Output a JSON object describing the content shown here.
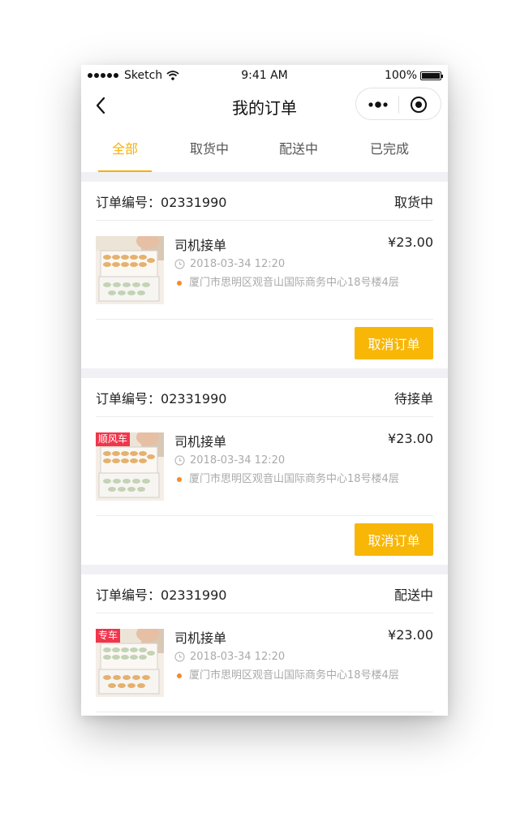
{
  "status_bar": {
    "carrier": "Sketch",
    "time": "9:41 AM",
    "battery": "100%"
  },
  "nav": {
    "title": "我的订单",
    "back_icon": "chevron-left-icon",
    "more_icon": "more-dots-icon",
    "close_icon": "target-circle-icon"
  },
  "tabs": [
    {
      "label": "全部",
      "active": true
    },
    {
      "label": "取货中",
      "active": false
    },
    {
      "label": "配送中",
      "active": false
    },
    {
      "label": "已完成",
      "active": false
    }
  ],
  "colors": {
    "accent": "#f6b10a",
    "button": "#f8b607",
    "tag": "#f0364c",
    "address_dot": "#f58a2a"
  },
  "orders": [
    {
      "order_label": "订单编号：",
      "order_no": "02331990",
      "status": "取货中",
      "item_title": "司机接单",
      "price": "¥23.00",
      "time": "2018-03-34 12:20",
      "address": "厦门市思明区观音山国际商务中心18号楼4层",
      "tag": "",
      "action": "取消订单"
    },
    {
      "order_label": "订单编号：",
      "order_no": "02331990",
      "status": "待接单",
      "item_title": "司机接单",
      "price": "¥23.00",
      "time": "2018-03-34 12:20",
      "address": "厦门市思明区观音山国际商务中心18号楼4层",
      "tag": "顺风车",
      "action": "取消订单"
    },
    {
      "order_label": "订单编号：",
      "order_no": "02331990",
      "status": "配送中",
      "item_title": "司机接单",
      "price": "¥23.00",
      "time": "2018-03-34 12:20",
      "address": "厦门市思明区观音山国际商务中心18号楼4层",
      "tag": "专车",
      "action": ""
    }
  ]
}
